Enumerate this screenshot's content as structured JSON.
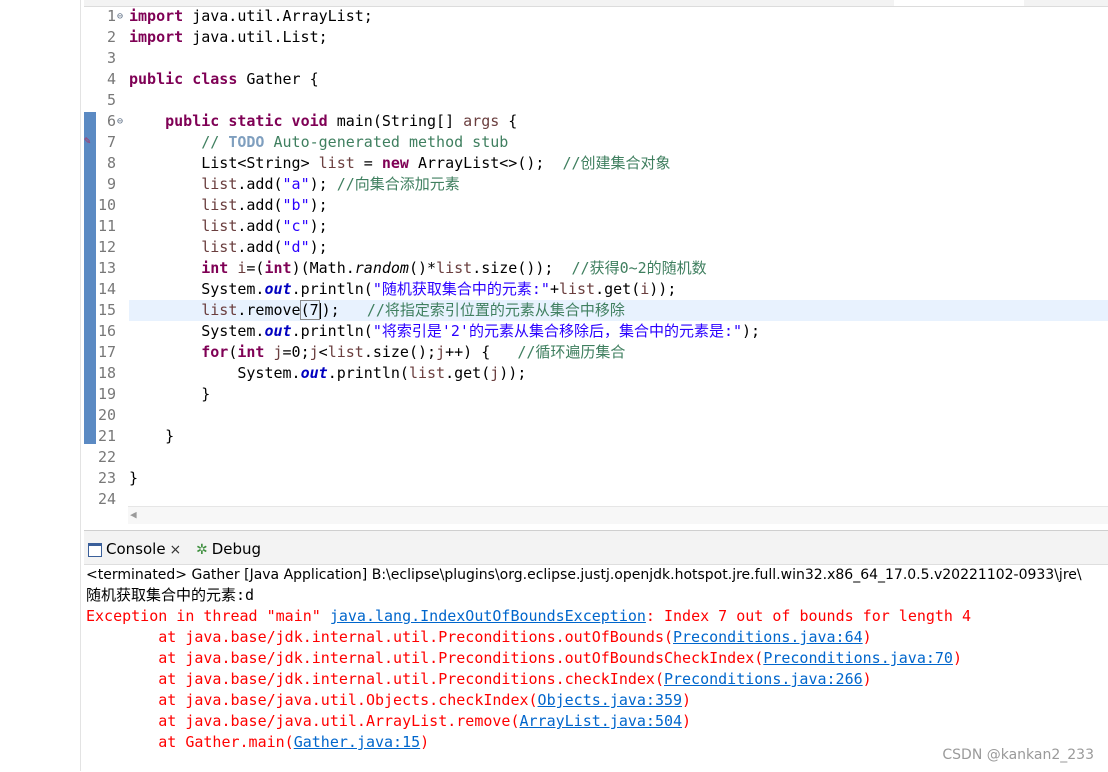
{
  "editor": {
    "lines": [
      {
        "n": "1",
        "fold": "⊖",
        "parts": [
          [
            "kw",
            "import"
          ],
          [
            "",
            "java.util.ArrayList;"
          ]
        ]
      },
      {
        "n": "2",
        "fold": "",
        "parts": [
          [
            "kw",
            "import"
          ],
          [
            "",
            "java.util.List;"
          ]
        ]
      },
      {
        "n": "3",
        "fold": "",
        "parts": []
      },
      {
        "n": "4",
        "fold": "",
        "parts": [
          [
            "kw",
            "public class"
          ],
          [
            "",
            "Gather {"
          ]
        ]
      },
      {
        "n": "5",
        "fold": "",
        "parts": []
      },
      {
        "n": "6",
        "fold": "⊖",
        "parts": [
          [
            "",
            "    "
          ],
          [
            "kw",
            "public static void"
          ],
          [
            "",
            " main(String[] "
          ],
          [
            "var",
            "args"
          ],
          [
            "",
            " {"
          ]
        ]
      },
      {
        "n": "7",
        "fold": "",
        "parts": [
          [
            "",
            "        "
          ],
          [
            "cm",
            "// "
          ],
          [
            "todo",
            "TODO"
          ],
          [
            "cm",
            " Auto-generated method stub"
          ]
        ]
      },
      {
        "n": "8",
        "fold": "",
        "parts": [
          [
            "",
            "        List<String> "
          ],
          [
            "var",
            "list"
          ],
          [
            "",
            " = "
          ],
          [
            "kw",
            "new"
          ],
          [
            "",
            " ArrayList<>();  "
          ],
          [
            "cm",
            "//创建集合对象"
          ]
        ]
      },
      {
        "n": "9",
        "fold": "",
        "parts": [
          [
            "",
            "        "
          ],
          [
            "var",
            "list"
          ],
          [
            "",
            ".add("
          ],
          [
            "str",
            "\"a\""
          ],
          [
            "",
            "); "
          ],
          [
            "cm",
            "//向集合添加元素"
          ]
        ]
      },
      {
        "n": "10",
        "fold": "",
        "parts": [
          [
            "",
            "        "
          ],
          [
            "var",
            "list"
          ],
          [
            "",
            ".add("
          ],
          [
            "str",
            "\"b\""
          ],
          [
            "",
            ");"
          ]
        ]
      },
      {
        "n": "11",
        "fold": "",
        "parts": [
          [
            "",
            "        "
          ],
          [
            "var",
            "list"
          ],
          [
            "",
            ".add("
          ],
          [
            "str",
            "\"c\""
          ],
          [
            "",
            ");"
          ]
        ]
      },
      {
        "n": "12",
        "fold": "",
        "parts": [
          [
            "",
            "        "
          ],
          [
            "var",
            "list"
          ],
          [
            "",
            ".add("
          ],
          [
            "str",
            "\"d\""
          ],
          [
            "",
            ");"
          ]
        ]
      },
      {
        "n": "13",
        "fold": "",
        "parts": [
          [
            "",
            "        "
          ],
          [
            "kw",
            "int"
          ],
          [
            "",
            " "
          ],
          [
            "var",
            "i"
          ],
          [
            "",
            "=("
          ],
          [
            "kw",
            "int"
          ],
          [
            "",
            ")(Math."
          ],
          [
            "ital",
            "random"
          ],
          [
            "",
            "()*"
          ],
          [
            "var",
            "list"
          ],
          [
            "",
            ".size());  "
          ],
          [
            "cm",
            "//获得0~2的随机数"
          ]
        ]
      },
      {
        "n": "14",
        "fold": "",
        "parts": [
          [
            "",
            "        System."
          ],
          [
            "fld",
            "out"
          ],
          [
            "",
            ".println("
          ],
          [
            "str",
            "\"随机获取集合中的元素:\""
          ],
          [
            "",
            "+"
          ],
          [
            "var",
            "list"
          ],
          [
            "",
            ".get("
          ],
          [
            "var",
            "i"
          ],
          [
            "",
            "));"
          ]
        ]
      },
      {
        "n": "15",
        "fold": "",
        "parts": [
          [
            "",
            "        "
          ],
          [
            "var",
            "list"
          ],
          [
            "",
            ".remove"
          ],
          [
            "box",
            "(7"
          ],
          [
            "caret",
            ""
          ],
          [
            "",
            ");   "
          ],
          [
            "cm",
            "//将指定索引位置的元素从集合中移除"
          ]
        ]
      },
      {
        "n": "16",
        "fold": "",
        "parts": [
          [
            "",
            "        System."
          ],
          [
            "fld",
            "out"
          ],
          [
            "",
            ".println("
          ],
          [
            "str",
            "\"将索引是'2'的元素从集合移除后，集合中的元素是:\""
          ],
          [
            "",
            ");"
          ]
        ]
      },
      {
        "n": "17",
        "fold": "",
        "parts": [
          [
            "",
            "        "
          ],
          [
            "kw",
            "for"
          ],
          [
            "",
            "("
          ],
          [
            "kw",
            "int"
          ],
          [
            "",
            " "
          ],
          [
            "var",
            "j"
          ],
          [
            "",
            "=0;"
          ],
          [
            "var",
            "j"
          ],
          [
            "",
            "<"
          ],
          [
            "var",
            "list"
          ],
          [
            "",
            ".size();"
          ],
          [
            "var",
            "j"
          ],
          [
            "",
            "++) {   "
          ],
          [
            "cm",
            "//循环遍历集合"
          ]
        ]
      },
      {
        "n": "18",
        "fold": "",
        "parts": [
          [
            "",
            "            System."
          ],
          [
            "fld",
            "out"
          ],
          [
            "",
            ".println("
          ],
          [
            "var",
            "list"
          ],
          [
            "",
            ".get("
          ],
          [
            "var",
            "j"
          ],
          [
            "",
            "));"
          ]
        ]
      },
      {
        "n": "19",
        "fold": "",
        "parts": [
          [
            "",
            "        }"
          ]
        ]
      },
      {
        "n": "20",
        "fold": "",
        "parts": []
      },
      {
        "n": "21",
        "fold": "",
        "parts": [
          [
            "",
            "    }"
          ]
        ]
      },
      {
        "n": "22",
        "fold": "",
        "parts": []
      },
      {
        "n": "23",
        "fold": "",
        "parts": [
          [
            "",
            "}"
          ]
        ]
      },
      {
        "n": "24",
        "fold": "",
        "parts": []
      }
    ]
  },
  "console": {
    "tab_console": "Console",
    "tab_debug": "Debug",
    "close_glyph": "×",
    "terminated": "<terminated> Gather [Java Application] B:\\eclipse\\plugins\\org.eclipse.justj.openjdk.hotspot.jre.full.win32.x86_64_17.0.5.v20221102-0933\\jre\\",
    "stdout": "随机获取集合中的元素:d",
    "exception_prefix": "Exception in thread \"main\" ",
    "exception_link": "java.lang.IndexOutOfBoundsException",
    "exception_msg": ": Index 7 out of bounds for length 4",
    "trace": [
      {
        "text": "        at java.base/jdk.internal.util.Preconditions.outOfBounds(",
        "link": "Preconditions.java:64",
        "end": ")"
      },
      {
        "text": "        at java.base/jdk.internal.util.Preconditions.outOfBoundsCheckIndex(",
        "link": "Preconditions.java:70",
        "end": ")"
      },
      {
        "text": "        at java.base/jdk.internal.util.Preconditions.checkIndex(",
        "link": "Preconditions.java:266",
        "end": ")"
      },
      {
        "text": "        at java.base/java.util.Objects.checkIndex(",
        "link": "Objects.java:359",
        "end": ")"
      },
      {
        "text": "        at java.base/java.util.ArrayList.remove(",
        "link": "ArrayList.java:504",
        "end": ")"
      },
      {
        "text": "        at Gather.main(",
        "link": "Gather.java:15",
        "end": ")"
      }
    ]
  },
  "watermark": "CSDN @kankan2_233",
  "colors": {
    "keyword": "#7f0055",
    "comment": "#3f7f5f",
    "string": "#2a00ff",
    "error": "#ff0000",
    "link": "#0066cc"
  }
}
